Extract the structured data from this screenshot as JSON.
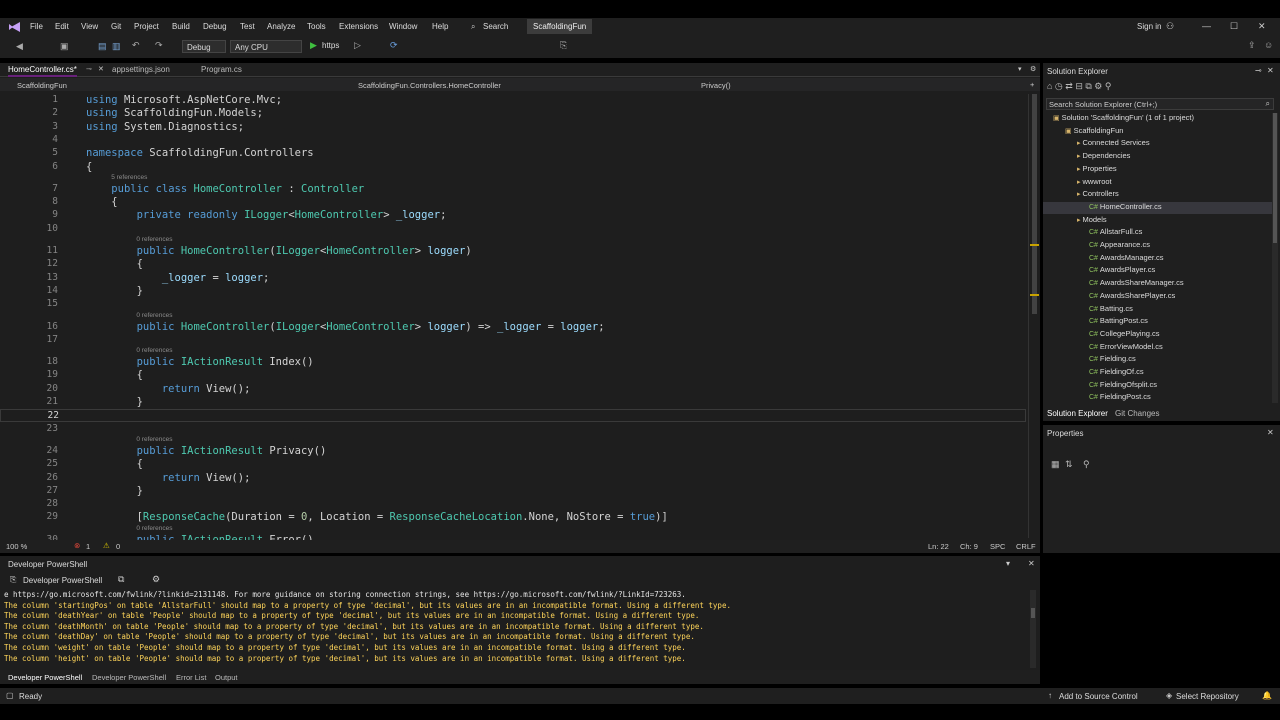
{
  "menu": [
    "File",
    "Edit",
    "View",
    "Git",
    "Project",
    "Build",
    "Debug",
    "Test",
    "Analyze",
    "Tools",
    "Extensions",
    "Window",
    "Help"
  ],
  "search_label": "Search",
  "solution_badge": "ScaffoldingFun",
  "sign_in": "Sign in",
  "toolbar": {
    "config": "Debug",
    "platform": "Any CPU",
    "run": "https"
  },
  "tabs": [
    {
      "label": "HomeController.cs*",
      "active": true
    },
    {
      "label": "appsettings.json",
      "active": false
    },
    {
      "label": "Program.cs",
      "active": false
    }
  ],
  "nav": {
    "project": "ScaffoldingFun",
    "class": "ScaffoldingFun.Controllers.HomeController",
    "member": "Privacy()"
  },
  "editor_status": {
    "zoom": "100 %",
    "errors": "1",
    "warnings": "0",
    "position": "Ln: 22",
    "column": "Ch: 9",
    "spacing": "SPC",
    "eol": "CRLF"
  },
  "code_lines": [
    {
      "n": "1",
      "t": "using Microsoft.AspNetCore.Mvc;"
    },
    {
      "n": "2",
      "t": "using ScaffoldingFun.Models;"
    },
    {
      "n": "3",
      "t": "using System.Diagnostics;"
    },
    {
      "n": "4",
      "t": ""
    },
    {
      "n": "5",
      "t": "namespace ScaffoldingFun.Controllers"
    },
    {
      "n": "6",
      "t": "{"
    },
    {
      "n": "7",
      "t": "    public class HomeController : Controller",
      "refs": "5 references"
    },
    {
      "n": "8",
      "t": "    {"
    },
    {
      "n": "9",
      "t": "        private readonly ILogger<HomeController> _logger;"
    },
    {
      "n": "10",
      "t": ""
    },
    {
      "n": "11",
      "t": "        public HomeController(ILogger<HomeController> logger)",
      "refs": "0 references"
    },
    {
      "n": "12",
      "t": "        {"
    },
    {
      "n": "13",
      "t": "            _logger = logger;"
    },
    {
      "n": "14",
      "t": "        }"
    },
    {
      "n": "15",
      "t": ""
    },
    {
      "n": "16",
      "t": "        public HomeController(ILogger<HomeController> logger) => _logger = logger;",
      "refs": "0 references"
    },
    {
      "n": "17",
      "t": ""
    },
    {
      "n": "18",
      "t": "        public IActionResult Index()",
      "refs": "0 references"
    },
    {
      "n": "19",
      "t": "        {"
    },
    {
      "n": "20",
      "t": "            return View();"
    },
    {
      "n": "21",
      "t": "        }"
    },
    {
      "n": "22",
      "t": ""
    },
    {
      "n": "23",
      "t": ""
    },
    {
      "n": "24",
      "t": "        public IActionResult Privacy()",
      "refs": "0 references"
    },
    {
      "n": "25",
      "t": "        {"
    },
    {
      "n": "26",
      "t": "            return View();"
    },
    {
      "n": "27",
      "t": "        }"
    },
    {
      "n": "28",
      "t": ""
    },
    {
      "n": "29",
      "t": "        [ResponseCache(Duration = 0, Location = ResponseCacheLocation.None, NoStore = true)]"
    },
    {
      "n": "30",
      "t": "        public IActionResult Error()",
      "refs": "0 references"
    }
  ],
  "solution_explorer": {
    "title": "Solution Explorer",
    "search_placeholder": "Search Solution Explorer (Ctrl+;)",
    "items": [
      {
        "label": "Solution 'ScaffoldingFun' (1 of 1 project)",
        "depth": 0
      },
      {
        "label": "ScaffoldingFun",
        "depth": 1
      },
      {
        "label": "Connected Services",
        "depth": 2
      },
      {
        "label": "Dependencies",
        "depth": 2
      },
      {
        "label": "Properties",
        "depth": 2
      },
      {
        "label": "wwwroot",
        "depth": 2
      },
      {
        "label": "Controllers",
        "depth": 2
      },
      {
        "label": "HomeController.cs",
        "depth": 3
      },
      {
        "label": "Models",
        "depth": 2
      },
      {
        "label": "AllstarFull.cs",
        "depth": 3
      },
      {
        "label": "Appearance.cs",
        "depth": 3
      },
      {
        "label": "AwardsManager.cs",
        "depth": 3
      },
      {
        "label": "AwardsPlayer.cs",
        "depth": 3
      },
      {
        "label": "AwardsShareManager.cs",
        "depth": 3
      },
      {
        "label": "AwardsSharePlayer.cs",
        "depth": 3
      },
      {
        "label": "Batting.cs",
        "depth": 3
      },
      {
        "label": "BattingPost.cs",
        "depth": 3
      },
      {
        "label": "CollegePlaying.cs",
        "depth": 3
      },
      {
        "label": "ErrorViewModel.cs",
        "depth": 3
      },
      {
        "label": "Fielding.cs",
        "depth": 3
      },
      {
        "label": "FieldingOf.cs",
        "depth": 3
      },
      {
        "label": "FieldingOfsplit.cs",
        "depth": 3
      },
      {
        "label": "FieldingPost.cs",
        "depth": 3
      }
    ],
    "bottom_tabs": [
      "Solution Explorer",
      "Git Changes"
    ]
  },
  "properties_title": "Properties",
  "output": {
    "title": "Developer PowerShell",
    "dropdown": "Developer PowerShell",
    "lines": [
      "e https://go.microsoft.com/fwlink/?linkid=2131148. For more guidance on storing connection strings, see https://go.microsoft.com/fwlink/?LinkId=723263.",
      "The column 'startingPos' on table 'AllstarFull' should map to a property of type 'decimal', but its values are in an incompatible format. Using a different type.",
      "The column 'deathYear' on table 'People' should map to a property of type 'decimal', but its values are in an incompatible format. Using a different type.",
      "The column 'deathMonth' on table 'People' should map to a property of type 'decimal', but its values are in an incompatible format. Using a different type.",
      "The column 'deathDay' on table 'People' should map to a property of type 'decimal', but its values are in an incompatible format. Using a different type.",
      "The column 'weight' on table 'People' should map to a property of type 'decimal', but its values are in an incompatible format. Using a different type.",
      "The column 'height' on table 'People' should map to a property of type 'decimal', but its values are in an incompatible format. Using a different type."
    ]
  },
  "bottom_tabs": [
    "Developer PowerShell",
    "Developer PowerShell",
    "Error List",
    "Output"
  ],
  "status": {
    "left": "Ready",
    "source_control": "Add to Source Control",
    "repo": "Select Repository"
  },
  "colors": {
    "accent": "#68217a",
    "keyword": "#569cd6",
    "type": "#4ec9b0",
    "warning_text": "#ffd55a"
  }
}
